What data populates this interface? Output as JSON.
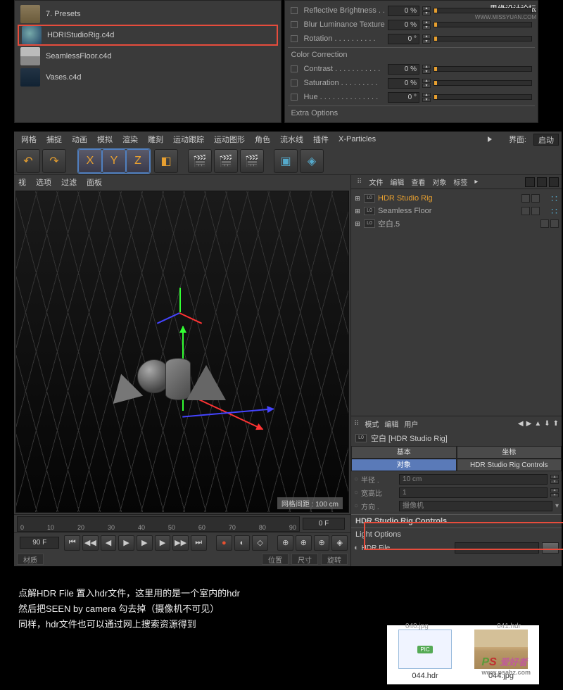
{
  "watermark": {
    "text1": "思缘设计论坛",
    "text2": "WWW.MISSYUAN.COM"
  },
  "files": {
    "presets": "7. Presets",
    "hdri": "HDRIStudioRig.c4d",
    "floor": "SeamlessFloor.c4d",
    "vases": "Vases.c4d"
  },
  "props": {
    "refl_bright": {
      "label": "Reflective Brightness . .",
      "val": "0 %"
    },
    "blur_lum": {
      "label": "Blur Luminance Texture",
      "val": "0 %"
    },
    "rotation": {
      "label": "Rotation . . . . . . . . . .",
      "val": "0 °"
    },
    "color_corr": "Color Correction",
    "contrast": {
      "label": "Contrast . . . . . . . . . . .",
      "val": "0 %"
    },
    "saturation": {
      "label": "Saturation  . . . . . . . . .",
      "val": "0 %"
    },
    "hue": {
      "label": "Hue  . . . . . . . . . . . . . .",
      "val": "0 °"
    },
    "extra": "Extra Options"
  },
  "menu": {
    "items": [
      "网格",
      "捕捉",
      "动画",
      "模拟",
      "渲染",
      "雕刻",
      "运动跟踪",
      "运动图形",
      "角色",
      "流水线",
      "插件",
      "X-Particles"
    ],
    "ui": "界面:",
    "launch": "启动"
  },
  "vp_tabs": {
    "view": "视",
    "opts": "选项",
    "filter": "过滤",
    "panel": "面板"
  },
  "vp_footer": "网格间距 : 100 cm",
  "ruler": {
    "ticks": [
      "0",
      "10",
      "20",
      "30",
      "40",
      "50",
      "60",
      "70",
      "80",
      "90"
    ],
    "end": "0 F",
    "start": "90 F"
  },
  "obj_menu": {
    "items": [
      "文件",
      "编辑",
      "查看",
      "对象",
      "标签"
    ]
  },
  "objects": {
    "hdr": "HDR Studio Rig",
    "floor": "Seamless Floor",
    "null": "空白.5"
  },
  "attr_menu": {
    "mode": "模式",
    "edit": "编辑",
    "user": "用户"
  },
  "attr_title": "空白 [HDR Studio Rig]",
  "attr_tabs": {
    "basic": "基本",
    "coord": "坐标",
    "object": "对象",
    "controls": "HDR Studio Rig Controls"
  },
  "attr_rows": {
    "radius": {
      "lbl": "半径 .",
      "val": "10 cm"
    },
    "aspect": {
      "lbl": "宽高比",
      "val": "1"
    },
    "orient": {
      "lbl": "方向 .",
      "val": "摄像机"
    }
  },
  "hdr_section": "HDR Studio Rig Controls",
  "light_opts": "Light Options",
  "hdr_file": {
    "label": "HDR File . . . . . . . . . . . . .",
    "btn": "..."
  },
  "status": {
    "a": "材质",
    "b": "位置",
    "c": "尺寸",
    "d": "旋转"
  },
  "tutorial": {
    "l1": "点解HDR File 置入hdr文件，这里用的是一个室内的hdr",
    "l2": "然后把SEEN by camera 勾去掉（摄像机不可见）",
    "l3": "同样，hdr文件也可以通过网上搜索资源得到"
  },
  "previews": {
    "top1": "040.jpg",
    "top2": "041.hdr",
    "f1": "044.hdr",
    "f2": "044.jpg",
    "pic": "PIC"
  },
  "pslogo": {
    "t": "爱好者",
    "d": "www.psahz.com"
  },
  "btns": {
    "x": "X",
    "y": "Y",
    "z": "Z"
  }
}
